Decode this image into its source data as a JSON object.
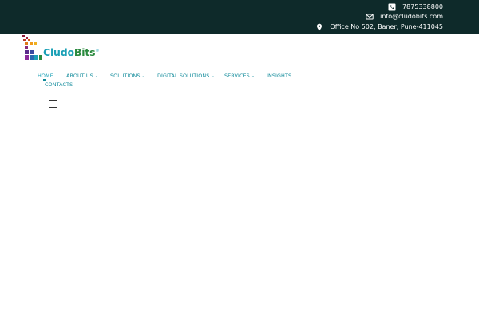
{
  "topbar": {
    "phone": {
      "icon": "phone-icon",
      "text": "7875338800"
    },
    "email": {
      "icon": "envelope-icon",
      "text": "info@cludobits.com"
    },
    "address": {
      "icon": "map-marker-icon",
      "text": "Office No 502, Baner, Pune-411045"
    }
  },
  "brand": {
    "name_part1": "Cludo",
    "name_part2": "Bits",
    "registered": "®"
  },
  "nav": {
    "home": "HOME",
    "about": "ABOUT US",
    "solutions": "SOLUTIONS",
    "digital": "DIGITAL SOLUTIONS",
    "services": "SERVICES",
    "insights": "INSIGHTS",
    "contacts": "CONTACTS",
    "chevron": "⌄"
  },
  "colors": {
    "topbar_bg": "#0e2a2a",
    "nav_text": "#0f8a9a",
    "brand_blue": "#1aa0b6",
    "brand_green": "#2a8a3e"
  }
}
